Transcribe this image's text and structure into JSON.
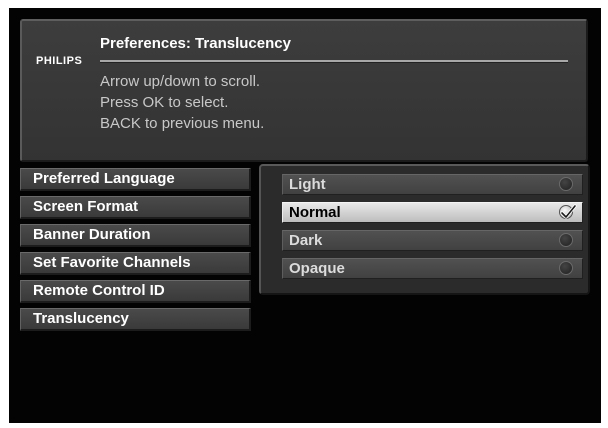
{
  "header": {
    "brand": "PHILIPS",
    "title": "Preferences: Translucency",
    "instructions": [
      "Arrow up/down to scroll.",
      "Press OK to select.",
      "BACK to previous menu."
    ]
  },
  "menu": {
    "items": [
      {
        "label": "Preferred Language"
      },
      {
        "label": "Screen Format"
      },
      {
        "label": "Banner Duration"
      },
      {
        "label": "Set Favorite Channels"
      },
      {
        "label": "Remote Control ID"
      },
      {
        "label": "Translucency"
      }
    ]
  },
  "options": {
    "items": [
      {
        "label": "Light",
        "selected": false
      },
      {
        "label": "Normal",
        "selected": true
      },
      {
        "label": "Dark",
        "selected": false
      },
      {
        "label": "Opaque",
        "selected": false
      }
    ],
    "selected_icon": "checkmark-icon",
    "unselected_icon": "radio-empty-icon"
  }
}
